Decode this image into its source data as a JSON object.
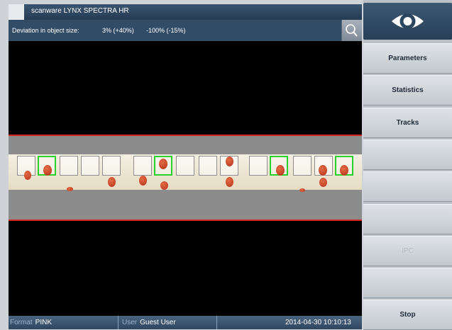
{
  "title": "scanware LYNX SPECTRA HR",
  "info": {
    "deviation_label": "Deviation in object size:",
    "value1": "3% (+40%)",
    "value2": "-100% (-15%)"
  },
  "icons": {
    "search": "search-icon",
    "eye": "eye-icon"
  },
  "status": {
    "format_label": "Format",
    "format_value": "PINK",
    "user_label": "User",
    "user_value": "Guest User",
    "datetime": "2014-04-30 10:10:13"
  },
  "menu": [
    {
      "label": "Parameters",
      "enabled": true
    },
    {
      "label": "Statistics",
      "enabled": true
    },
    {
      "label": "Tracks",
      "enabled": true
    },
    {
      "label": "",
      "enabled": true
    },
    {
      "label": "",
      "enabled": true
    },
    {
      "label": "",
      "enabled": true
    },
    {
      "label": "IPC",
      "enabled": false
    },
    {
      "label": "",
      "enabled": true
    },
    {
      "label": "Stop",
      "enabled": true
    }
  ],
  "colors": {
    "detected_frame": "#2bd12b",
    "belt_border": "#d0241f",
    "header": "#324c66"
  }
}
